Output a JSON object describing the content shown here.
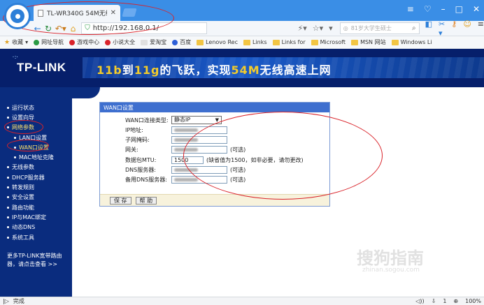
{
  "browser": {
    "tab_title": "TL-WR340G 54M无线",
    "tab_close": "✕",
    "url": "http://192.168.0.1/",
    "search_placeholder": "81岁大学生硕士",
    "zoom": "100%",
    "status_text": "完成",
    "count": "1"
  },
  "bookmarks": [
    "收藏",
    "网址导航",
    "游戏中心",
    "小说大全",
    "爱淘宝",
    "百度",
    "Lenovo Rec",
    "Links",
    "Links for",
    "Microsoft",
    "MSN 网站",
    "Windows Li"
  ],
  "banner": {
    "logo": "TP-LINK",
    "slogan_a": "11b",
    "slogan_b": "到",
    "slogan_c": "11g",
    "slogan_d": "的飞跃，实现",
    "slogan_e": "54M",
    "slogan_f": "无线高速上网"
  },
  "sidebar": {
    "items": [
      {
        "label": "运行状态",
        "sub": false
      },
      {
        "label": "设置向导",
        "sub": false
      },
      {
        "label": "网络参数",
        "sub": false,
        "active": true
      },
      {
        "label": "LAN口设置",
        "sub": true
      },
      {
        "label": "WAN口设置",
        "sub": true,
        "active": true
      },
      {
        "label": "MAC地址克隆",
        "sub": true
      },
      {
        "label": "无线参数",
        "sub": false
      },
      {
        "label": "DHCP服务器",
        "sub": false
      },
      {
        "label": "转发规则",
        "sub": false
      },
      {
        "label": "安全设置",
        "sub": false
      },
      {
        "label": "路由功能",
        "sub": false
      },
      {
        "label": "IP与MAC绑定",
        "sub": false
      },
      {
        "label": "动态DNS",
        "sub": false
      },
      {
        "label": "系统工具",
        "sub": false
      }
    ],
    "more_line1": "更多TP-LINK宽带路由",
    "more_line2": "器，请点击查看 >>"
  },
  "panel": {
    "title": "WAN口设置",
    "conn_type_label": "WAN口连接类型:",
    "conn_type_value": "静态IP",
    "ip_label": "IP地址:",
    "mask_label": "子网掩码:",
    "gateway_label": "网关:",
    "gateway_note": "(可选)",
    "mtu_label": "数据包MTU:",
    "mtu_value": "1500",
    "mtu_note": "(缺省值为1500，如非必要，请勿更改)",
    "dns_label": "DNS服务器:",
    "dns_note": "(可选)",
    "dns2_label": "备用DNS服务器:",
    "dns2_note": "(可选)",
    "save_label": "保 存",
    "help_label": "帮 助"
  },
  "watermark": {
    "text": "搜狗指南",
    "sub": "zhinan.sogou.com"
  }
}
